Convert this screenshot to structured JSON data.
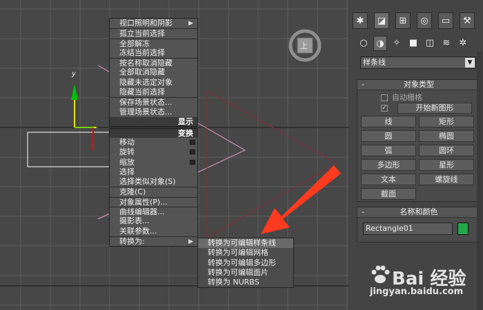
{
  "quad_menu": {
    "items_top": [
      "视口照明和阴影",
      "孤立当前选择",
      "全部解冻",
      "冻结当前选择",
      "按名称取消隐藏",
      "全部取消隐藏",
      "隐藏未选定对象",
      "隐藏当前选择",
      "保存场景状态...",
      "管理场景状态..."
    ],
    "display_header": "显示",
    "transform_header": "变换",
    "items_bottom": [
      "移动",
      "旋转",
      "缩放",
      "选择",
      "选择类似对象(S)",
      "克隆(C)",
      "对象属性(P)...",
      "曲线编辑器...",
      "摄影表...",
      "关联参数...",
      "转换为:"
    ]
  },
  "submenu": {
    "items": [
      "转换为可编辑样条线",
      "转换为可编辑网格",
      "转换为可编辑多边形",
      "转换为可编辑面片",
      "转换为 NURBS"
    ]
  },
  "viewport": {
    "axis_y": "y",
    "viewcube_label": "上"
  },
  "panel": {
    "category_dropdown": "样条线",
    "object_type": {
      "title": "对象类型",
      "collapse": "-",
      "autogrid": "自动栅格",
      "start_new_shape": "开始新图形",
      "buttons": [
        "线",
        "矩形",
        "圆",
        "椭圆",
        "弧",
        "圆环",
        "多边形",
        "星形",
        "文本",
        "螺旋线",
        "截面"
      ]
    },
    "name_color": {
      "title": "名称和颜色",
      "collapse": "-",
      "name": "Rectangle01",
      "color": "#22a84a"
    }
  },
  "watermark": {
    "brand": "Bai 经验",
    "url": "jingyan.baidu.com"
  }
}
